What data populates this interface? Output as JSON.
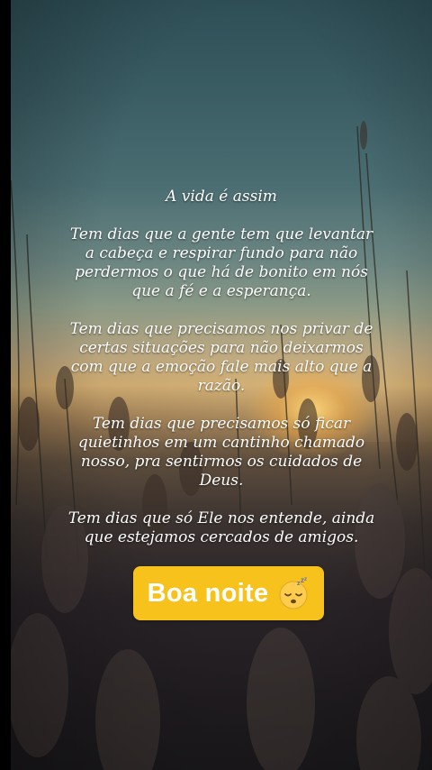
{
  "post": {
    "title": "A vida é assim",
    "paragraphs": [
      "Tem dias que a gente tem que levantar\na cabeça e respirar fundo para não\nperdermos o que há de bonito em nós\nque a fé e a esperança.",
      "Tem dias que precisamos nos privar de\ncertas situações para não deixarmos\ncom que a emoção fale mais alto que a\nrazão.",
      "Tem dias que precisamos só ficar\nquietinhos em um cantinho chamado\nnosso, pra sentirmos os cuidados de\nDeus.",
      "Tem dias que só Ele nos entende,  ainda\nque estejamos cercados de amigos."
    ]
  },
  "sticker": {
    "label": "Boa noite",
    "emoji": "sleeping-face-icon",
    "color": "#f6c21b"
  }
}
